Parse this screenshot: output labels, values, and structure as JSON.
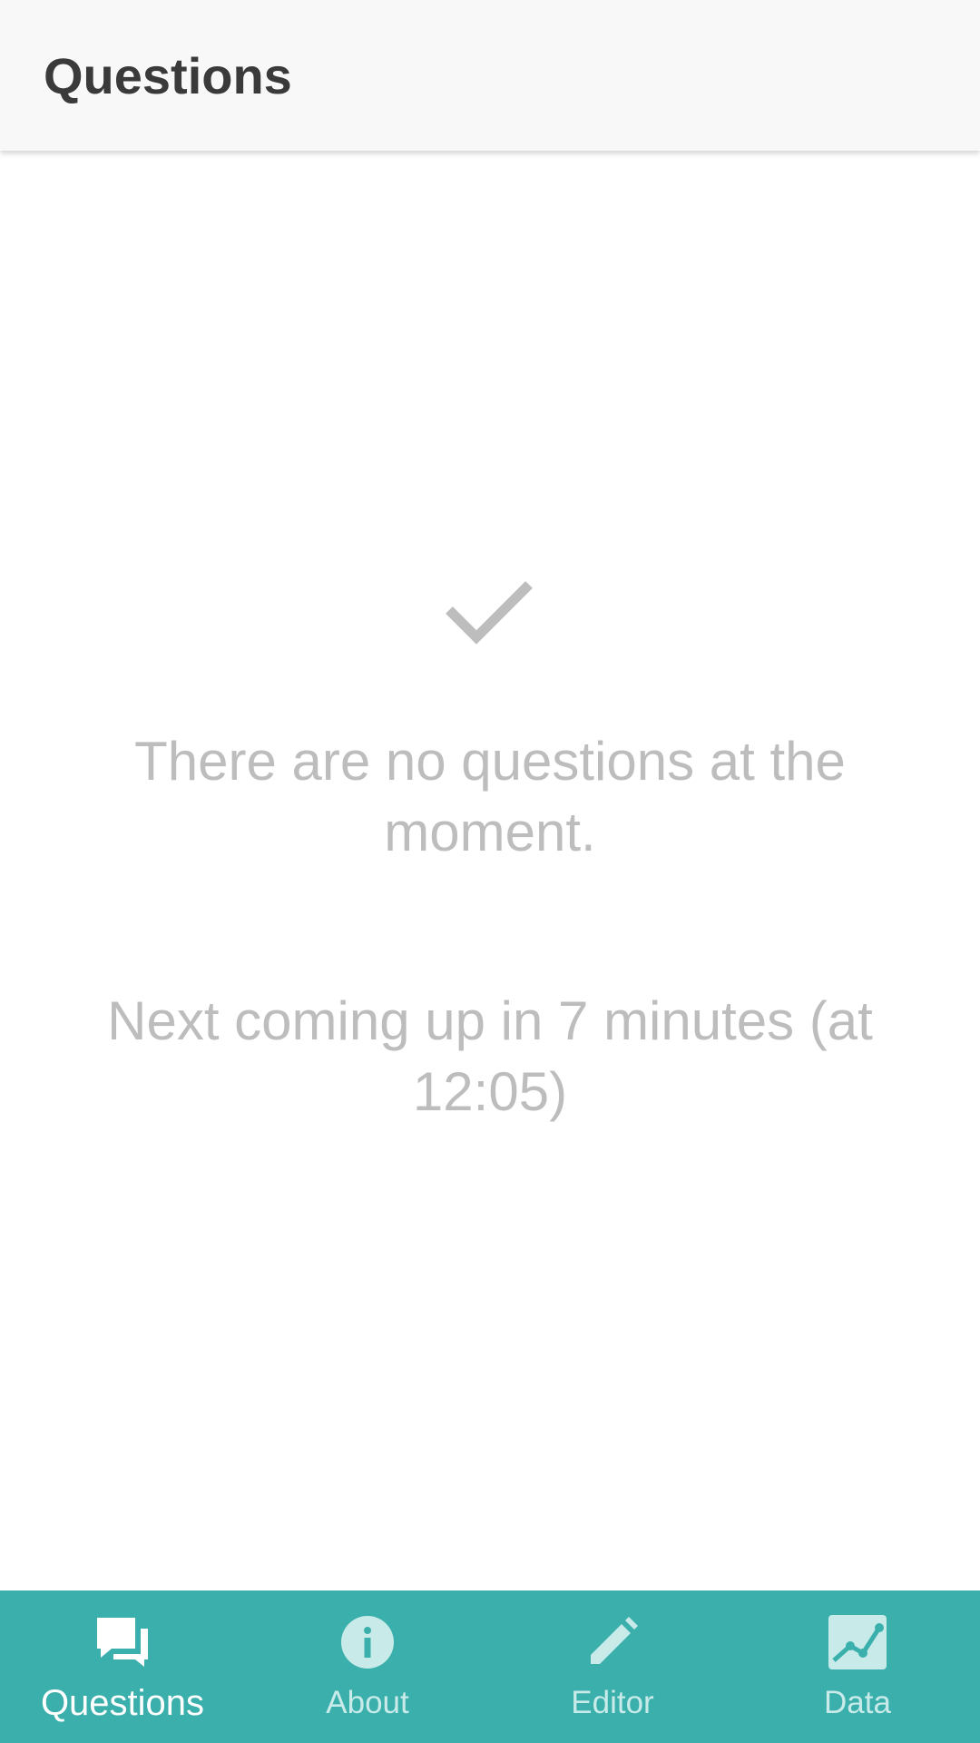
{
  "header": {
    "title": "Questions"
  },
  "empty_state": {
    "icon": "check-icon",
    "message": "There are no questions at the moment.",
    "next": "Next coming up in 7 minutes (at 12:05)"
  },
  "bottom_nav": {
    "items": [
      {
        "label": "Questions",
        "icon": "chat-icon",
        "active": true
      },
      {
        "label": "About",
        "icon": "info-icon",
        "active": false
      },
      {
        "label": "Editor",
        "icon": "pencil-icon",
        "active": false
      },
      {
        "label": "Data",
        "icon": "chart-icon",
        "active": false
      }
    ]
  },
  "colors": {
    "nav_background": "#3aafab",
    "nav_active": "#ffffff",
    "nav_inactive": "#c8ebe9",
    "empty_text": "#bdbdbd",
    "title_text": "#3a3a3a"
  }
}
